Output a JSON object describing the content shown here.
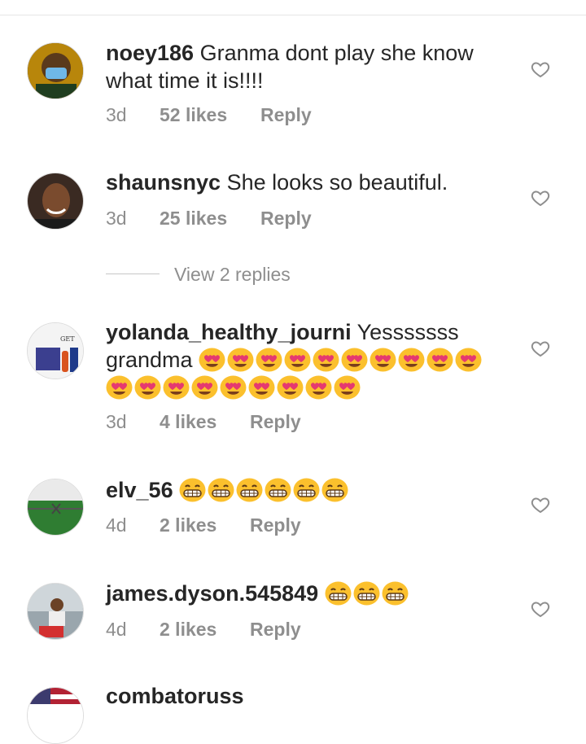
{
  "comments": [
    {
      "username": "noey186",
      "text": "Granma dont play she know what time it is!!!!",
      "emojis": "",
      "time": "3d",
      "likes": "52 likes",
      "reply": "Reply"
    },
    {
      "username": "shaunsnyc",
      "text": "She looks so beautiful.",
      "emojis": "",
      "time": "3d",
      "likes": "25 likes",
      "reply": "Reply",
      "view_replies": "View 2 replies"
    },
    {
      "username": "yolanda_healthy_journi",
      "text": "Yesssssss grandma",
      "emojis": "heart-eyes x19",
      "time": "3d",
      "likes": "4 likes",
      "reply": "Reply",
      "avatar_text": "GET"
    },
    {
      "username": "elv_56",
      "text": "",
      "emojis": "grinning x6",
      "time": "4d",
      "likes": "2 likes",
      "reply": "Reply"
    },
    {
      "username": "james.dyson.545849",
      "text": "",
      "emojis": "grinning x3",
      "time": "4d",
      "likes": "2 likes",
      "reply": "Reply"
    },
    {
      "username": "combatoruss",
      "text": "",
      "emojis": "",
      "time": "",
      "likes": "",
      "reply": ""
    }
  ],
  "colors": {
    "text": "#262626",
    "secondary": "#8e8e8e",
    "divider": "#c7c7c7"
  },
  "icons": {
    "like": "heart-outline-icon"
  }
}
